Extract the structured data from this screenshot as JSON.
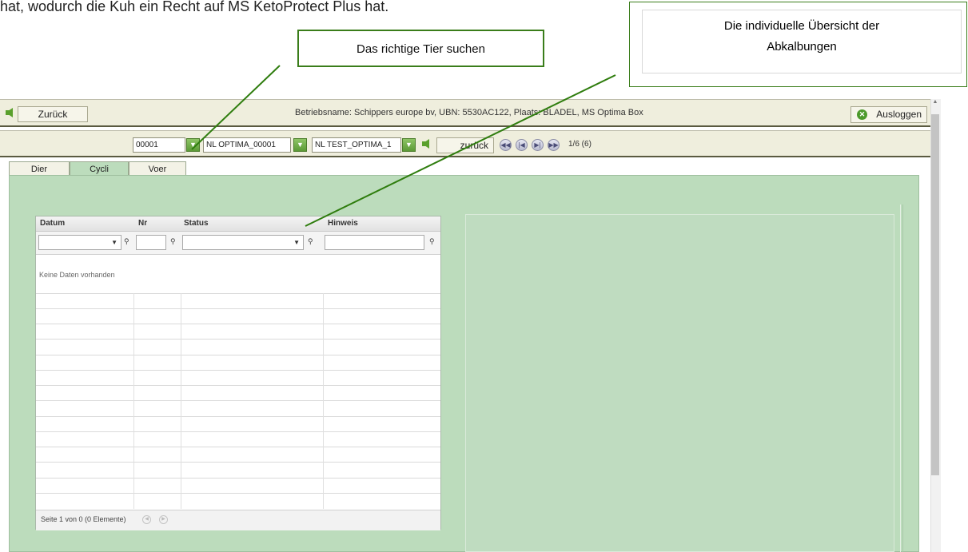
{
  "document": {
    "intro_line": "hat, wodurch die Kuh ein Recht auf MS KetoProtect Plus hat."
  },
  "callouts": {
    "search_animal": "Das richtige Tier suchen",
    "overview_line1": "Die individuelle Übersicht der",
    "overview_line2": "Abkalbungen",
    "line_color": "#2f7d0e"
  },
  "header": {
    "back_label": "Zurück",
    "title": "Betriebsname: Schippers europe bv, UBN: 5530AC122, Plaats: BLADEL, MS Optima Box",
    "logout_label": "Ausloggen"
  },
  "navbar": {
    "animal_number": "00001",
    "animal_id": "NL OPTIMA_00001",
    "group": "NL TEST_OPTIMA_1",
    "back_label": "zurück",
    "record_position": "1/6 (6)"
  },
  "tabs": [
    {
      "label": "Dier",
      "active": false
    },
    {
      "label": "Cycli",
      "active": true
    },
    {
      "label": "Voer",
      "active": false
    }
  ],
  "grid": {
    "columns": [
      "Datum",
      "Nr",
      "Status",
      "Hinweis"
    ],
    "empty_message": "Keine Daten vorhanden",
    "pager_text": "Seite 1 von 0 (0 Elemente)"
  },
  "colors": {
    "panel_bg": "#bcdcbc",
    "toolbar_bg": "#efeedd",
    "accent_green": "#5aa02c"
  }
}
